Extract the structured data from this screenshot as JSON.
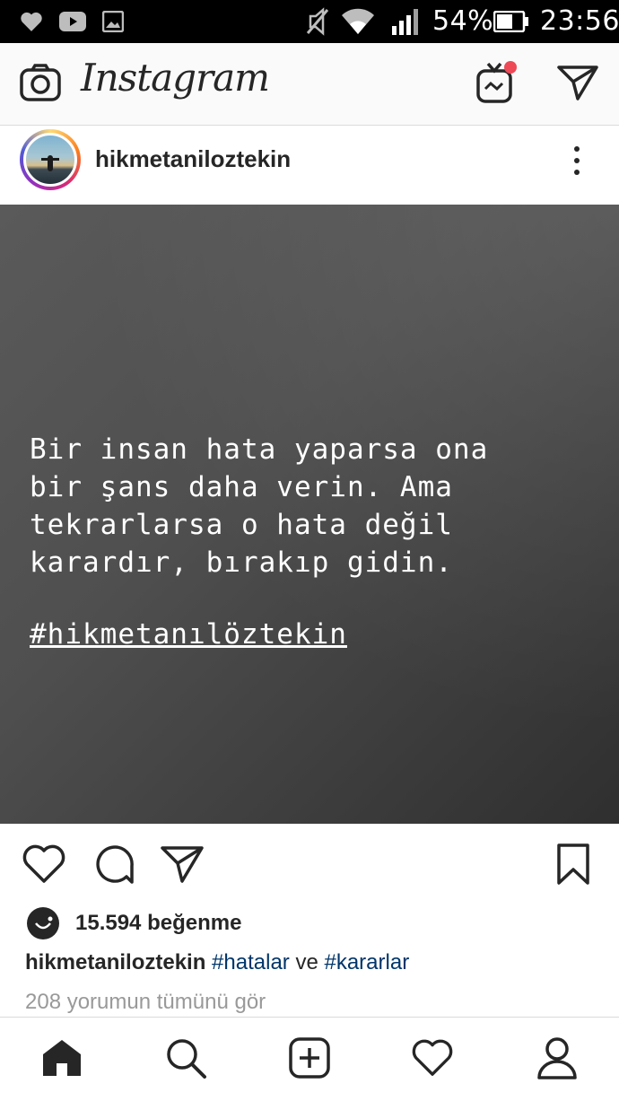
{
  "status_bar": {
    "battery_percent": "54%",
    "time": "23:56",
    "icons": [
      "heart-notification-icon",
      "youtube-notification-icon",
      "gallery-notification-icon",
      "mute-icon",
      "wifi-icon",
      "cellular-signal-icon",
      "battery-icon"
    ]
  },
  "header": {
    "brand": "Instagram",
    "left_icon": "camera-icon",
    "right_icons": [
      "igtv-icon",
      "direct-message-icon"
    ],
    "igtv_badge_color": "#ed4956"
  },
  "post": {
    "username": "hikmetaniloztekin",
    "image_text": "Bir insan hata yaparsa ona\nbir şans daha verin. Ama\ntekrarlarsa o hata değil\nkarardır, bırakıp gidin.",
    "image_hashtag": "#hikmetanılöztekin",
    "likes": "15.594 beğenme",
    "caption": {
      "user": "hikmetaniloztekin",
      "tag1": "#hatalar",
      "connector": "ve",
      "tag2": "#kararlar"
    },
    "comments_link": "208 yorumun tümünü gör"
  },
  "bottom_nav": {
    "items": [
      "home-icon",
      "search-icon",
      "new-post-icon",
      "activity-icon",
      "profile-icon"
    ]
  },
  "colors": {
    "text": "#262626",
    "hashtag": "#003569",
    "muted": "#999999",
    "divider": "#dbdbdb"
  }
}
